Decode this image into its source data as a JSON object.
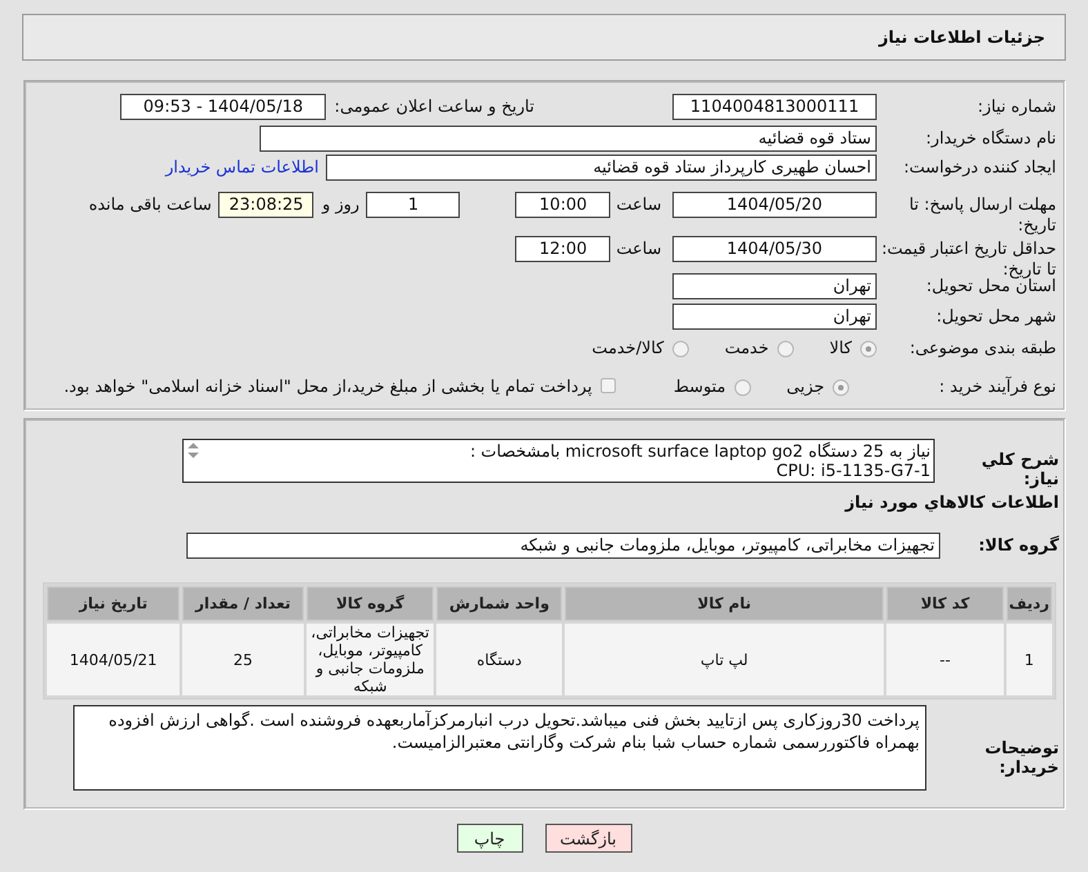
{
  "header": {
    "title": "جزئیات اطلاعات نیاز"
  },
  "details": {
    "need_number": {
      "label": "شماره نیاز:",
      "value": "1104004813000111"
    },
    "announce": {
      "label": "تاریخ و ساعت اعلان عمومی:",
      "value": "1404/05/18 - 09:53"
    },
    "buyer_org": {
      "label": "نام دستگاه خریدار:",
      "value": "ستاد قوه قضائیه"
    },
    "requester": {
      "label": "ایجاد کننده درخواست:",
      "value": "احسان طهیری کارپرداز ستاد قوه قضائیه",
      "link": "اطلاعات تماس خریدار"
    },
    "deadline": {
      "label": "مهلت ارسال پاسخ: تا تاریخ:",
      "date": "1404/05/20",
      "time_label": "ساعت",
      "time": "10:00",
      "days": "1",
      "days_label": "روز و",
      "remaining": "23:08:25",
      "remaining_label": "ساعت باقی مانده"
    },
    "validity": {
      "label": "حداقل تاریخ اعتبار قیمت: تا تاریخ:",
      "date": "1404/05/30",
      "time_label": "ساعت",
      "time": "12:00"
    },
    "province": {
      "label": "استان محل تحویل:",
      "value": "تهران"
    },
    "city": {
      "label": "شهر محل تحویل:",
      "value": "تهران"
    },
    "category": {
      "label": "طبقه بندی موضوعی:",
      "options": [
        {
          "label": "کالا",
          "selected": true
        },
        {
          "label": "خدمت",
          "selected": false
        },
        {
          "label": "کالا/خدمت",
          "selected": false
        }
      ]
    },
    "process": {
      "label": "نوع فرآیند خرید :",
      "options": [
        {
          "label": "جزیی",
          "selected": true
        },
        {
          "label": "متوسط",
          "selected": false
        }
      ],
      "payment_note": {
        "label": "پرداخت تمام یا بخشی از مبلغ خرید،از محل \"اسناد خزانه اسلامی\" خواهد بود.",
        "checked": false
      }
    }
  },
  "summary": {
    "label": "شرح کلي نياز:",
    "lines": [
      "نیاز به 25 دستگاه microsoft surface laptop go2 بامشخصات :",
      "CPU: i5-1135-G7-1"
    ]
  },
  "goods": {
    "title": "اطلاعات کالاهاي مورد نياز",
    "group_label": "گروه کالا:",
    "group_value": "تجهیزات مخابراتی، کامپیوتر، موبایل، ملزومات جانبی و شبکه",
    "table": {
      "columns": [
        "ردیف",
        "کد کالا",
        "نام کالا",
        "واحد شمارش",
        "گروه کالا",
        "تعداد / مقدار",
        "تاریخ نیاز"
      ],
      "rows": [
        {
          "cells": [
            "1",
            "--",
            "لپ تاپ",
            "دستگاه",
            "تجهیزات مخابراتی، کامپیوتر، موبایل، ملزومات جانبی و شبکه",
            "25",
            "1404/05/21"
          ]
        }
      ]
    }
  },
  "buyer_notes": {
    "label": "توضیحات خریدار:",
    "text": "پرداخت 30روزکاری پس ازتایید بخش فنی میباشد.تحویل درب انبارمرکزآماربعهده فروشنده است .گواهی ارزش افزوده بهمراه فاکتوررسمی شماره حساب شبا بنام شرکت وگارانتی معتبرالزامیست."
  },
  "buttons": [
    {
      "label": "بازگشت",
      "kind": "back"
    },
    {
      "label": "چاپ",
      "kind": "print"
    }
  ]
}
